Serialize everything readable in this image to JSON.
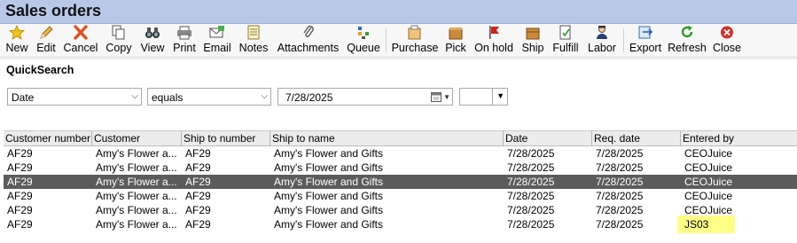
{
  "window": {
    "title": "Sales orders"
  },
  "toolbar": {
    "new": "New",
    "edit": "Edit",
    "cancel": "Cancel",
    "copy": "Copy",
    "view": "View",
    "print": "Print",
    "email": "Email",
    "notes": "Notes",
    "attachments": "Attachments",
    "queue": "Queue",
    "purchase": "Purchase",
    "pick": "Pick",
    "onhold": "On hold",
    "ship": "Ship",
    "fulfill": "Fulfill",
    "labor": "Labor",
    "export": "Export",
    "refresh": "Refresh",
    "close": "Close"
  },
  "quicksearch": {
    "title": "QuickSearch",
    "field": "Date",
    "operator": "equals",
    "value": "7/28/2025",
    "extra": ""
  },
  "grid": {
    "columns": [
      "Customer number",
      "Customer",
      "Ship to number",
      "Ship to name",
      "Date",
      "Req. date",
      "Entered by"
    ],
    "rows": [
      [
        "AF29",
        "Amy's Flower a...",
        "AF29",
        "Amy's Flower and Gifts",
        "7/28/2025",
        "7/28/2025",
        "CEOJuice"
      ],
      [
        "AF29",
        "Amy's Flower a...",
        "AF29",
        "Amy's Flower and Gifts",
        "7/28/2025",
        "7/28/2025",
        "CEOJuice"
      ],
      [
        "AF29",
        "Amy's Flower a...",
        "AF29",
        "Amy's Flower and Gifts",
        "7/28/2025",
        "7/28/2025",
        "CEOJuice"
      ],
      [
        "AF29",
        "Amy's Flower a...",
        "AF29",
        "Amy's Flower and Gifts",
        "7/28/2025",
        "7/28/2025",
        "CEOJuice"
      ],
      [
        "AF29",
        "Amy's Flower a...",
        "AF29",
        "Amy's Flower and Gifts",
        "7/28/2025",
        "7/28/2025",
        "CEOJuice"
      ],
      [
        "AF29",
        "Amy's Flower a...",
        "AF29",
        "Amy's Flower and Gifts",
        "7/28/2025",
        "7/28/2025",
        "JS03"
      ]
    ],
    "selected_row": 2
  },
  "colors": {
    "selection": "#5b5b5b",
    "highlight": "#ffff88",
    "title_bar": "#b8c8e6"
  }
}
